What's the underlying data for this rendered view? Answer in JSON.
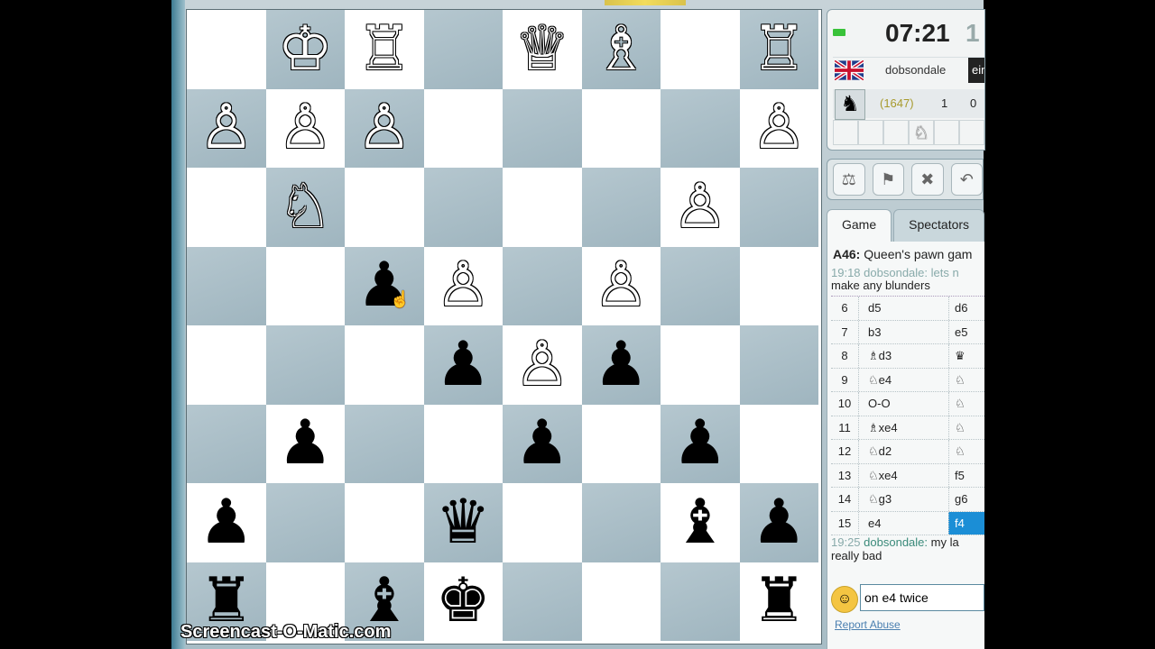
{
  "board": {
    "rows": [
      [
        "",
        "wK",
        "wR",
        "",
        "wQ",
        "wB",
        "",
        "wR"
      ],
      [
        "wP",
        "wP",
        "wP",
        "",
        "",
        "",
        "",
        "wP"
      ],
      [
        "",
        "wN",
        "",
        "",
        "",
        "",
        "wP",
        ""
      ],
      [
        "",
        "",
        "bP",
        "wP",
        "",
        "wP",
        "",
        ""
      ],
      [
        "",
        "",
        "",
        "bP",
        "wP",
        "bP",
        "",
        ""
      ],
      [
        "",
        "bP",
        "",
        "",
        "bP",
        "",
        "bP",
        ""
      ],
      [
        "bP",
        "",
        "",
        "bQ",
        "",
        "",
        "bB",
        "bP"
      ],
      [
        "bR",
        "",
        "bB",
        "bK",
        "",
        "",
        "",
        "bR"
      ]
    ],
    "glyphs": {
      "wK": "♔",
      "wQ": "♕",
      "wR": "♖",
      "wB": "♗",
      "wN": "♘",
      "wP": "♙",
      "bK": "♚",
      "bQ": "♛",
      "bR": "♜",
      "bB": "♝",
      "bN": "♞",
      "bP": "♟"
    }
  },
  "clock": {
    "time": "07:21",
    "next_time": "1"
  },
  "player": {
    "name": "dobsondale",
    "opponent_name": "ein",
    "rating": "(1647)",
    "score_a": "1",
    "score_b": "0",
    "flag": "uk-flag",
    "avatar": "horse-avatar"
  },
  "captured": [
    "",
    "",
    "",
    "♘",
    "",
    ""
  ],
  "toolbar": {
    "buttons": [
      "offer-draw-icon",
      "resign-icon",
      "close-icon",
      "undo-icon"
    ]
  },
  "tabs": {
    "game": "Game",
    "spectators": "Spectators"
  },
  "opening": {
    "code": "A46:",
    "name": "Queen's pawn gam"
  },
  "chat_top": {
    "time": "19:18",
    "name": "dobsondale:",
    "text_tail": "lets n",
    "line2": "make any blunders"
  },
  "moves": [
    {
      "num": "6",
      "white": "d5",
      "black": "d6"
    },
    {
      "num": "7",
      "white": "b3",
      "black": "e5"
    },
    {
      "num": "8",
      "white": "♗d3",
      "black": "♛"
    },
    {
      "num": "9",
      "white": "♘e4",
      "black": "♘"
    },
    {
      "num": "10",
      "white": "O-O",
      "black": "♘"
    },
    {
      "num": "11",
      "white": "♗xe4",
      "black": "♘"
    },
    {
      "num": "12",
      "white": "♘d2",
      "black": "♘"
    },
    {
      "num": "13",
      "white": "♘xe4",
      "black": "f5"
    },
    {
      "num": "14",
      "white": "♘g3",
      "black": "g6"
    },
    {
      "num": "15",
      "white": "e4",
      "black": "f4"
    }
  ],
  "chat_bottom": {
    "time": "19:25",
    "name": "dobsondale:",
    "text": "my la",
    "line2": "really bad"
  },
  "chat_input": {
    "value": "on e4 twice"
  },
  "report_abuse": "Report Abuse",
  "watermark": "Screencast-O-Matic.com"
}
